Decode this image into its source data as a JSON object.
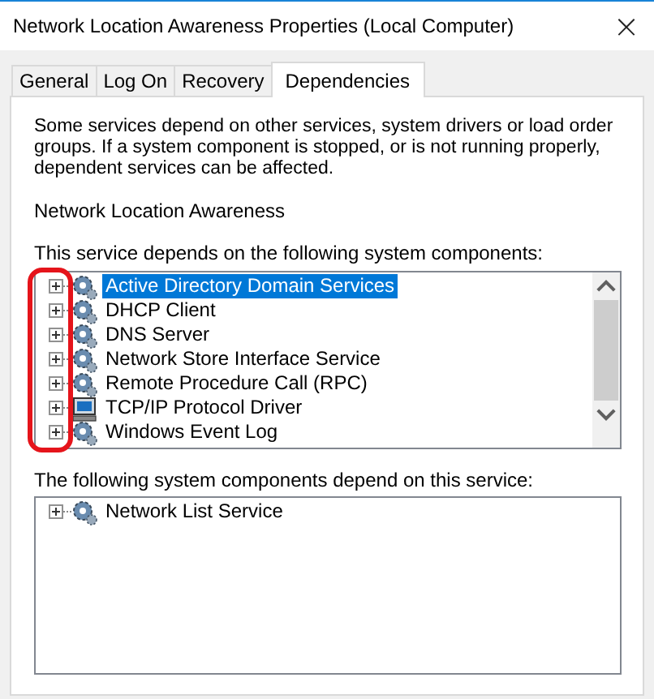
{
  "window": {
    "title": "Network Location Awareness Properties (Local Computer)",
    "close": "×"
  },
  "tabs": [
    {
      "label": "General",
      "selected": false
    },
    {
      "label": "Log On",
      "selected": false
    },
    {
      "label": "Recovery",
      "selected": false
    },
    {
      "label": "Dependencies",
      "selected": true
    }
  ],
  "description": "Some services depend on other services, system drivers or load order groups. If a system component is stopped, or is not running properly, dependent services can be affected.",
  "service_name": "Network Location Awareness",
  "depends_on": {
    "label": "This service depends on the following system components:",
    "items": [
      {
        "label": "Active Directory Domain Services",
        "kind": "service",
        "selected": true,
        "expanded": false
      },
      {
        "label": "DHCP Client",
        "kind": "service",
        "selected": false,
        "expanded": false
      },
      {
        "label": "DNS Server",
        "kind": "service",
        "selected": false,
        "expanded": false
      },
      {
        "label": "Network Store Interface Service",
        "kind": "service",
        "selected": false,
        "expanded": false
      },
      {
        "label": "Remote Procedure Call (RPC)",
        "kind": "service",
        "selected": false,
        "expanded": false
      },
      {
        "label": "TCP/IP Protocol Driver",
        "kind": "driver",
        "selected": false,
        "expanded": false
      },
      {
        "label": "Windows Event Log",
        "kind": "service",
        "selected": false,
        "expanded": false
      }
    ]
  },
  "dependents": {
    "label": "The following system components depend on this service:",
    "items": [
      {
        "label": "Network List Service",
        "kind": "service",
        "selected": false,
        "expanded": false
      }
    ]
  }
}
